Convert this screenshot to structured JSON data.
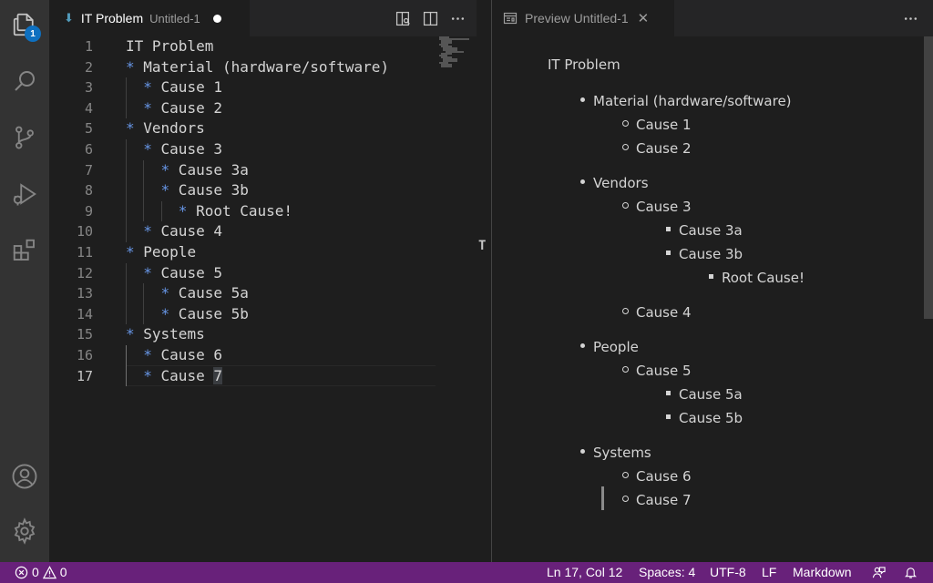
{
  "activity_bar": {
    "items": [
      {
        "name": "explorer",
        "icon": "files-icon",
        "badge": "1"
      },
      {
        "name": "search",
        "icon": "search-icon"
      },
      {
        "name": "source-control",
        "icon": "source-control-icon"
      },
      {
        "name": "run-debug",
        "icon": "run-debug-icon"
      },
      {
        "name": "extensions",
        "icon": "extensions-icon"
      }
    ],
    "bottom": [
      {
        "name": "accounts",
        "icon": "account-icon"
      },
      {
        "name": "manage",
        "icon": "gear-icon"
      }
    ]
  },
  "editor": {
    "tab": {
      "title": "IT Problem",
      "description": "Untitled-1",
      "icon": "markdown-file-icon",
      "dirty": true
    },
    "line_numbers": [
      "1",
      "2",
      "3",
      "4",
      "5",
      "6",
      "7",
      "8",
      "9",
      "10",
      "11",
      "12",
      "13",
      "14",
      "15",
      "16",
      "17"
    ],
    "lines": [
      {
        "indent": "",
        "star": "",
        "text": "IT Problem"
      },
      {
        "indent": "",
        "star": "*",
        "text": " Material (hardware/software)"
      },
      {
        "indent": "  ",
        "star": "*",
        "text": " Cause 1"
      },
      {
        "indent": "  ",
        "star": "*",
        "text": " Cause 2"
      },
      {
        "indent": "",
        "star": "*",
        "text": " Vendors"
      },
      {
        "indent": "  ",
        "star": "*",
        "text": " Cause 3"
      },
      {
        "indent": "    ",
        "star": "*",
        "text": " Cause 3a"
      },
      {
        "indent": "    ",
        "star": "*",
        "text": " Cause 3b"
      },
      {
        "indent": "      ",
        "star": "*",
        "text": " Root Cause!"
      },
      {
        "indent": "  ",
        "star": "*",
        "text": " Cause 4"
      },
      {
        "indent": "",
        "star": "*",
        "text": " People"
      },
      {
        "indent": "  ",
        "star": "*",
        "text": " Cause 5"
      },
      {
        "indent": "    ",
        "star": "*",
        "text": " Cause 5a"
      },
      {
        "indent": "    ",
        "star": "*",
        "text": " Cause 5b"
      },
      {
        "indent": "",
        "star": "*",
        "text": " Systems"
      },
      {
        "indent": "  ",
        "star": "*",
        "text": " Cause 6"
      },
      {
        "indent": "  ",
        "star": "*",
        "text": " Cause ",
        "selected": "7"
      }
    ],
    "active_line": "17"
  },
  "preview": {
    "tab": {
      "title": "Preview Untitled-1",
      "icon": "preview-icon"
    },
    "title": "IT Problem",
    "items": [
      {
        "level": 1,
        "text": "Material (hardware/software)"
      },
      {
        "level": 2,
        "text": "Cause 1"
      },
      {
        "level": 2,
        "text": "Cause 2"
      },
      {
        "level": 1,
        "text": "Vendors"
      },
      {
        "level": 2,
        "text": "Cause 3"
      },
      {
        "level": 3,
        "text": "Cause 3a"
      },
      {
        "level": 3,
        "text": "Cause 3b"
      },
      {
        "level": 4,
        "text": "Root Cause!"
      },
      {
        "level": 2,
        "text": "Cause 4"
      },
      {
        "level": 1,
        "text": "People"
      },
      {
        "level": 2,
        "text": "Cause 5"
      },
      {
        "level": 3,
        "text": "Cause 5a"
      },
      {
        "level": 3,
        "text": "Cause 5b"
      },
      {
        "level": 1,
        "text": "Systems"
      },
      {
        "level": 2,
        "text": "Cause 6"
      },
      {
        "level": 2,
        "text": "Cause 7"
      }
    ]
  },
  "status_bar": {
    "errors": "0",
    "warnings": "0",
    "position": "Ln 17, Col 12",
    "spaces": "Spaces: 4",
    "encoding": "UTF-8",
    "eol": "LF",
    "language": "Markdown"
  },
  "colors": {
    "status_bar": "#68217a",
    "activity_bar": "#333333",
    "editor_bg": "#1e1e1e",
    "list_marker": "#6796e6",
    "badge": "#0e70c0"
  }
}
